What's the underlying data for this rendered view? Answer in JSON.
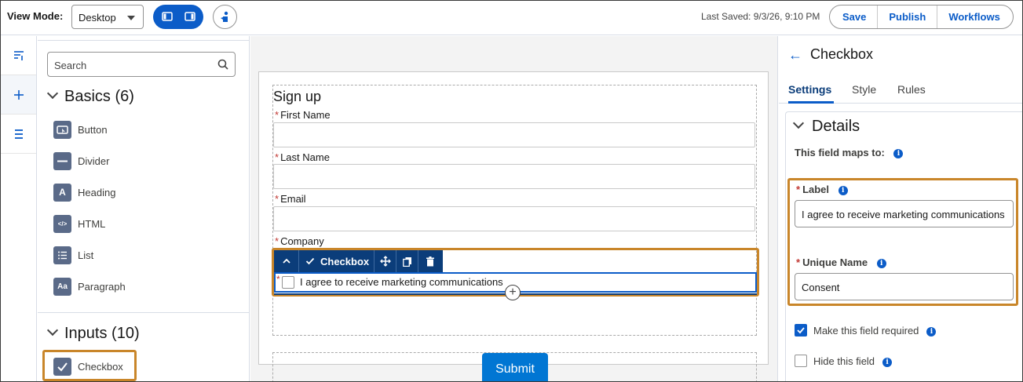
{
  "topbar": {
    "view_mode_label": "View Mode:",
    "view_mode_value": "Desktop",
    "last_saved": "Last Saved: 9/3/26, 9:10 PM",
    "save_label": "Save",
    "publish_label": "Publish",
    "workflows_label": "Workflows"
  },
  "components": {
    "search_placeholder": "Search",
    "basics_title": "Basics (6)",
    "basics": [
      {
        "label": "Button",
        "icon": "button-icon",
        "glyph": ""
      },
      {
        "label": "Divider",
        "icon": "divider-icon",
        "glyph": ""
      },
      {
        "label": "Heading",
        "icon": "heading-icon",
        "glyph": "A"
      },
      {
        "label": "HTML",
        "icon": "html-icon",
        "glyph": "</>"
      },
      {
        "label": "List",
        "icon": "list-icon",
        "glyph": ""
      },
      {
        "label": "Paragraph",
        "icon": "paragraph-icon",
        "glyph": "Aa"
      }
    ],
    "inputs_title": "Inputs (10)",
    "inputs": [
      {
        "label": "Checkbox",
        "icon": "checkbox-icon"
      }
    ]
  },
  "form": {
    "title": "Sign up",
    "fields": [
      {
        "label": "First Name",
        "required": "*"
      },
      {
        "label": "Last Name",
        "required": "*"
      },
      {
        "label": "Email",
        "required": "*"
      },
      {
        "label": "Company",
        "required": "*"
      }
    ],
    "checkbox_toolbar_label": "Checkbox",
    "checkbox_required": "*",
    "checkbox_text": "I agree to receive marketing communications",
    "submit_label": "Submit"
  },
  "properties": {
    "title": "Checkbox",
    "tabs": [
      "Settings",
      "Style",
      "Rules"
    ],
    "active_tab": "Settings",
    "details_title": "Details",
    "maps_label": "This field maps to:",
    "label_label": "Label",
    "label_value": "I agree to receive marketing communications",
    "unique_name_label": "Unique Name",
    "unique_name_value": "Consent",
    "required_label": "Make this field required",
    "required_checked": true,
    "hide_label": "Hide this field",
    "hide_checked": false,
    "required_mark": "*",
    "info_glyph": "i"
  },
  "colors": {
    "brand": "#0b5cc8",
    "highlight": "#c9862a",
    "required": "#c23934",
    "submit": "#0176d3",
    "toolbar": "#0b3d7a"
  }
}
